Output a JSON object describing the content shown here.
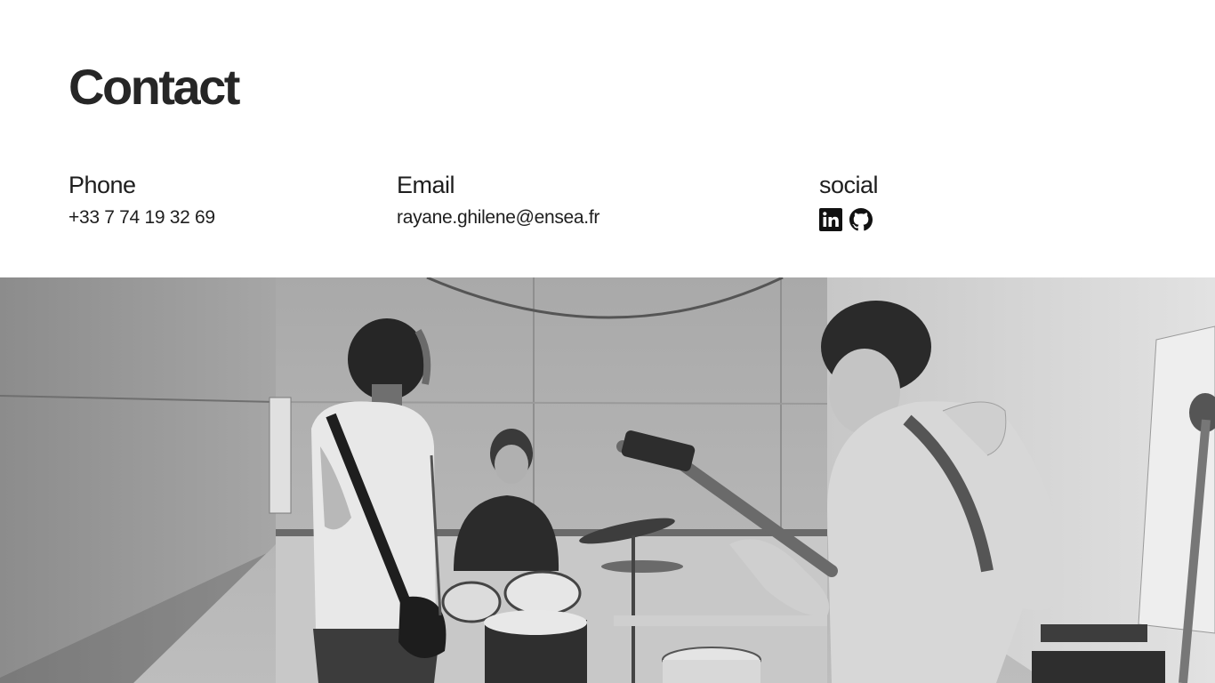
{
  "page": {
    "title": "Contact"
  },
  "contact": {
    "phone": {
      "label": "Phone",
      "value": "+33 7 74 19 32 69"
    },
    "email": {
      "label": "Email",
      "value": "rayane.ghilene@ensea.fr"
    },
    "social": {
      "label": "social",
      "links": [
        {
          "icon": "linkedin-icon"
        },
        {
          "icon": "github-icon"
        }
      ]
    }
  },
  "photo": {
    "subject": "band-rehearsal-photo",
    "style": "grayscale"
  }
}
